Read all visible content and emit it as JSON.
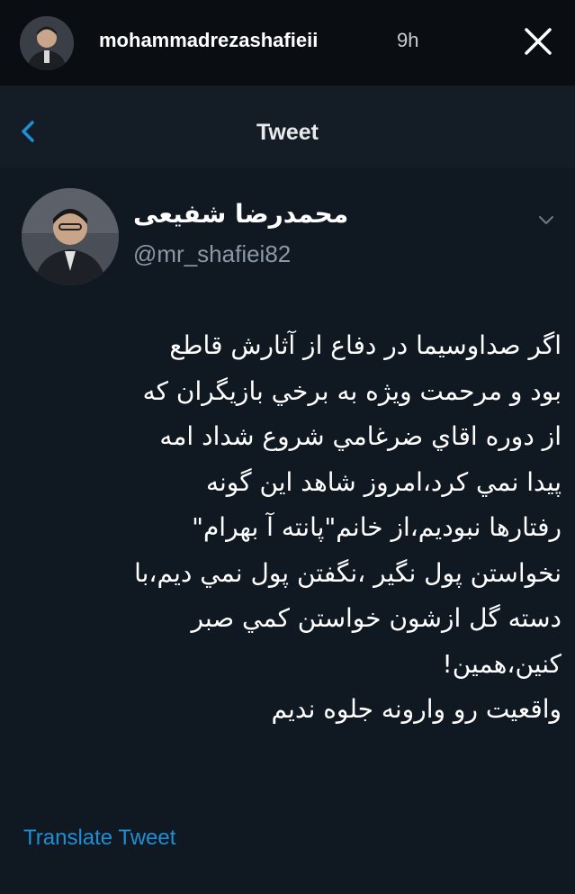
{
  "story": {
    "username": "mohammadrezashafieii",
    "time": "9h"
  },
  "nav": {
    "title": "Tweet"
  },
  "tweet": {
    "display_name": "محمدرضا شفیعی",
    "handle": "@mr_shafiei82",
    "lines": [
      "اگر صداوسيما در دفاع از آثارش قاطع",
      "بود و مرحمت ويژه به برخي بازيگران كه",
      "از دوره اقاي ضرغامي شروع شداد امه",
      "پيدا نمي كرد،امروز شاهد اين گونه",
      "رفتارها نبوديم،از خانم\"پانته آ بهرام\"",
      "نخواستن پول نگير ،نگفتن پول نمي ديم،با",
      "دسته گل ازشون خواستن كمي صبر",
      "كنين،همين!",
      "واقعيت رو وارونه جلوه نديم"
    ],
    "translate_label": "Translate Tweet"
  },
  "colors": {
    "background": "#101822",
    "nav_background": "#141d26",
    "accent": "#1d8fd6",
    "handle": "#8b98a5"
  },
  "icons": {
    "close": "close-icon",
    "back": "chevron-left-icon",
    "caret": "chevron-down-icon"
  }
}
